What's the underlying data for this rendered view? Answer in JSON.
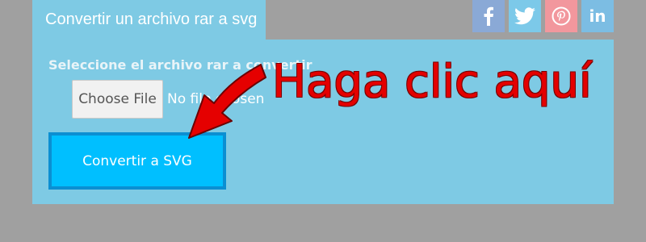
{
  "tab": {
    "title": "Convertir un archivo rar a svg"
  },
  "social": [
    {
      "name": "facebook",
      "icon": "facebook-icon",
      "color": "#8aa9d6"
    },
    {
      "name": "twitter",
      "icon": "twitter-icon",
      "color": "#7cc9e9"
    },
    {
      "name": "pinterest",
      "icon": "pinterest-icon",
      "color": "#f2979d"
    },
    {
      "name": "linkedin",
      "icon": "linkedin-icon",
      "label": "in",
      "color": "#7cbde3"
    }
  ],
  "form": {
    "select_label": "Seleccione el archivo rar a convertir",
    "file_button": "Choose File",
    "file_status": "No file chosen",
    "convert_button": "Convertir a SVG"
  },
  "annotation": {
    "text": "Haga clic aquí",
    "color": "#e40000"
  },
  "colors": {
    "background": "#a0a0a0",
    "panel": "#7ecae4",
    "button": "#00bfff",
    "button_border": "#0b8fd2"
  }
}
